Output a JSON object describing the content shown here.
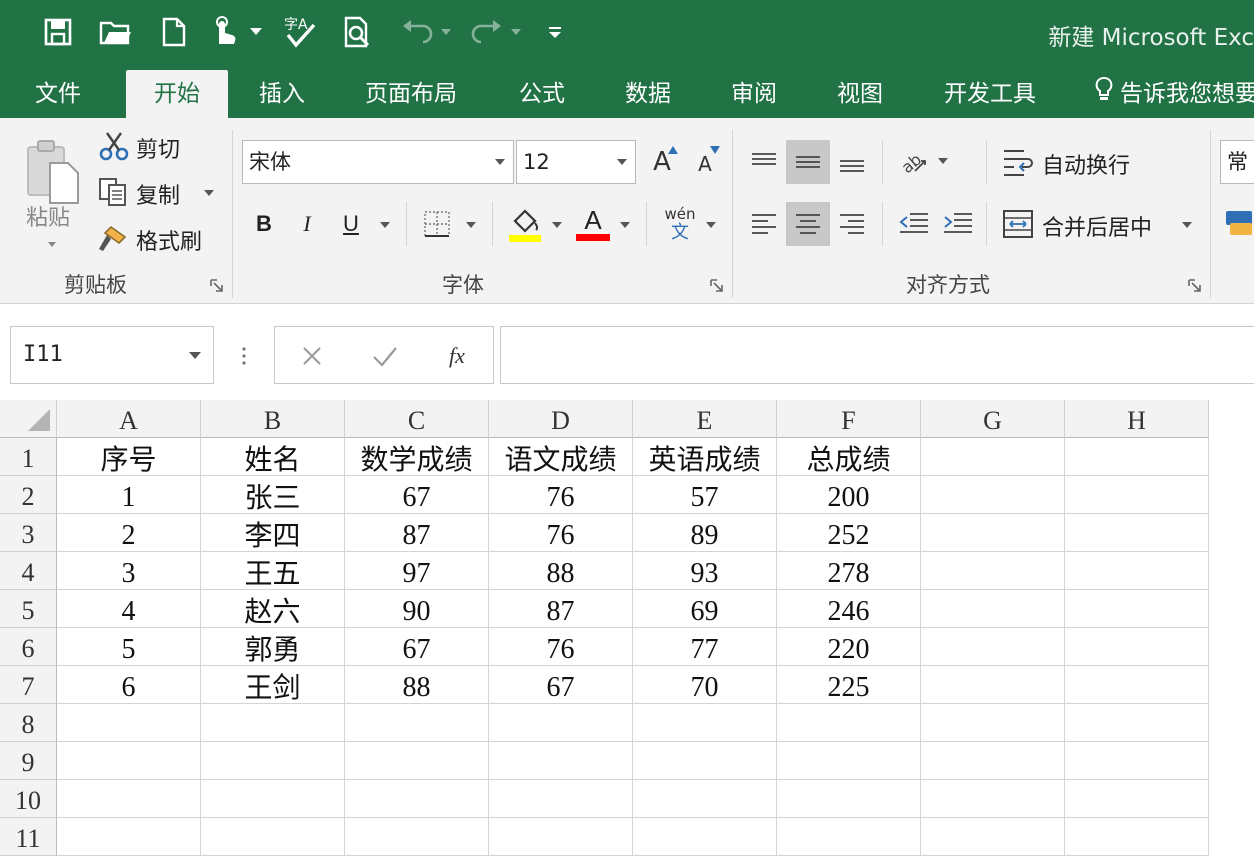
{
  "title": "新建 Microsoft Exc",
  "tabs": [
    "文件",
    "开始",
    "插入",
    "页面布局",
    "公式",
    "数据",
    "审阅",
    "视图",
    "开发工具"
  ],
  "tell_me": "告诉我您想要",
  "clipboard": {
    "paste": "粘贴",
    "cut": "剪切",
    "copy": "复制",
    "format_painter": "格式刷",
    "group_label": "剪贴板"
  },
  "font": {
    "name": "宋体",
    "size": "12",
    "phonetic": "wén",
    "phonetic_char": "文",
    "bold": "B",
    "italic": "I",
    "underline": "U",
    "grow": "A",
    "shrink": "A",
    "color_label": "A",
    "group_label": "字体"
  },
  "alignment": {
    "wrap_text": "自动换行",
    "merge_center": "合并后居中",
    "group_label": "对齐方式"
  },
  "number": {
    "format": "常规"
  },
  "formula_bar": {
    "name_box": "I11",
    "fx": "fx",
    "value": ""
  },
  "colors": {
    "brand": "#217346",
    "highlight": "#ffff00",
    "font_color": "#ff0000"
  },
  "sheet": {
    "columns": [
      "A",
      "B",
      "C",
      "D",
      "E",
      "F",
      "G",
      "H"
    ],
    "row_numbers": [
      "1",
      "2",
      "3",
      "4",
      "5",
      "6",
      "7",
      "8",
      "9",
      "10",
      "11"
    ],
    "header": [
      "序号",
      "姓名",
      "数学成绩",
      "语文成绩",
      "英语成绩",
      "总成绩"
    ],
    "rows": [
      [
        "1",
        "张三",
        "67",
        "76",
        "57",
        "200"
      ],
      [
        "2",
        "李四",
        "87",
        "76",
        "89",
        "252"
      ],
      [
        "3",
        "王五",
        "97",
        "88",
        "93",
        "278"
      ],
      [
        "4",
        "赵六",
        "90",
        "87",
        "69",
        "246"
      ],
      [
        "5",
        "郭勇",
        "67",
        "76",
        "77",
        "220"
      ],
      [
        "6",
        "王剑",
        "88",
        "67",
        "70",
        "225"
      ]
    ]
  }
}
